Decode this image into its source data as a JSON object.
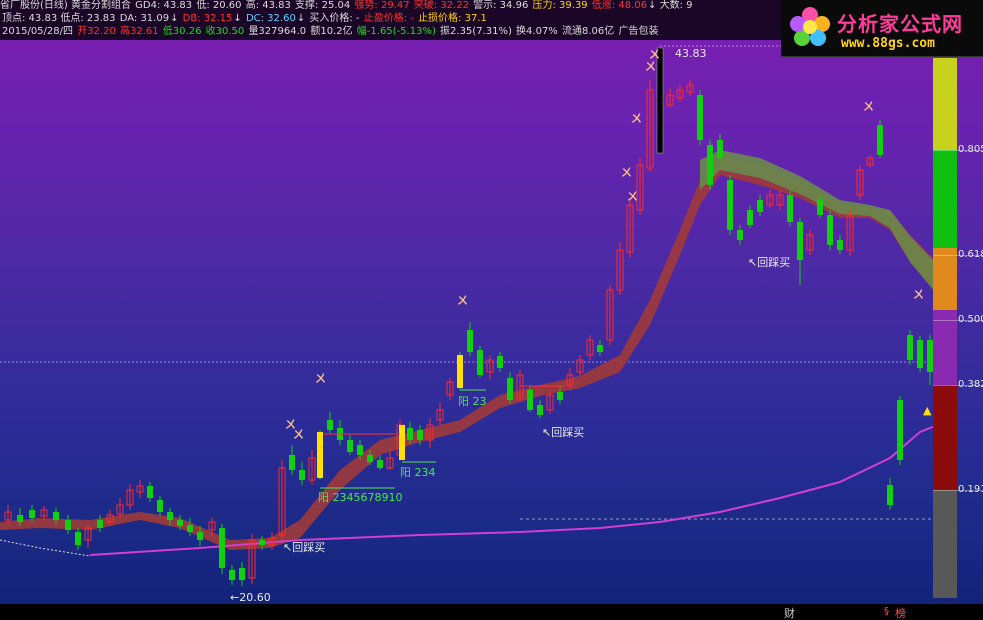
{
  "header": {
    "line1": [
      {
        "text": "省厂股份(日线) 黄金分割组合",
        "color": "w"
      },
      {
        "text": " GD4: 43.83",
        "color": "w"
      },
      {
        "text": " 低: 20.60",
        "color": "w"
      },
      {
        "text": " 高: 43.83",
        "color": "w"
      },
      {
        "text": " 支撑: 25.04",
        "color": "w"
      },
      {
        "text": " 强势: 29.47",
        "color": "r"
      },
      {
        "text": " 突破: 32.22",
        "color": "r"
      },
      {
        "text": " 警示: 34.96",
        "color": "w"
      },
      {
        "text": " 压力: 39.39",
        "color": "y"
      },
      {
        "text": " 低涨: 48.06",
        "color": "r"
      },
      {
        "text": "↓ 大数: 9",
        "color": "w"
      }
    ],
    "line2": [
      {
        "text": "顶点: 43.83 低点: 23.83",
        "color": "w"
      },
      {
        "text": " DA: 31.09",
        "color": "w"
      },
      {
        "text": "↓ ",
        "color": "w"
      },
      {
        "text": "DB: 32.15",
        "color": "r"
      },
      {
        "text": "↓ ",
        "color": "w"
      },
      {
        "text": "DC: 32.60",
        "color": "c"
      },
      {
        "text": "↓",
        "color": "w"
      },
      {
        "text": " 买入价格: - ",
        "color": "w"
      },
      {
        "text": "止盈价格: - ",
        "color": "r"
      },
      {
        "text": "止损价格: 37.1",
        "color": "y"
      }
    ],
    "line3": [
      {
        "text": "2015/05/28/四 ",
        "color": "w"
      },
      {
        "text": "开32.20 ",
        "color": "r"
      },
      {
        "text": "高32.61 ",
        "color": "r"
      },
      {
        "text": "低30.26 ",
        "color": "g"
      },
      {
        "text": "收30.50 ",
        "color": "g"
      },
      {
        "text": "量327964.0 ",
        "color": "w"
      },
      {
        "text": "额10.2亿 ",
        "color": "w"
      },
      {
        "text": "幅-1.65(-5.13%) ",
        "color": "g"
      },
      {
        "text": "振2.35(7.31%) ",
        "color": "w"
      },
      {
        "text": "换4.07% ",
        "color": "w"
      },
      {
        "text": "流通8.06亿 ",
        "color": "w"
      },
      {
        "text": "广告包装",
        "color": "w"
      }
    ]
  },
  "logo": {
    "title": "分析家公式网",
    "url": "www.88gs.com"
  },
  "labels": {
    "high_price": "43.83",
    "low_price": "←20.60",
    "pullback_buy": "↖回踩买",
    "yang_1": "阳 2345678910",
    "yang_2": "阳 234",
    "yang_3": "阳 23",
    "sell_signal": "ㄨ",
    "buy_signal": "▲"
  },
  "fib_levels": [
    {
      "label": "0.805",
      "color": "#e8e8e8"
    },
    {
      "label": "0.618",
      "color": "#e8e8e8"
    },
    {
      "label": "0.500",
      "color": "#e8e8e8"
    },
    {
      "label": "0.382",
      "color": "#e8e8e8"
    },
    {
      "label": "0.191",
      "color": "#e8e8e8"
    }
  ],
  "scale_bands": [
    "#c8d21c",
    "#10c010",
    "#e08a1e",
    "#8a2ab0",
    "#8c0c0c",
    "#585858"
  ],
  "bottom_tabs": {
    "cai": "财",
    "bang": "榜",
    "marker": "§"
  },
  "colors": {
    "up": "#ff2a2a",
    "down": "#10d010",
    "ribbon_up": "#a03a3a",
    "ribbon_down": "#6a8a4a",
    "ma": "#d23ed2"
  }
}
